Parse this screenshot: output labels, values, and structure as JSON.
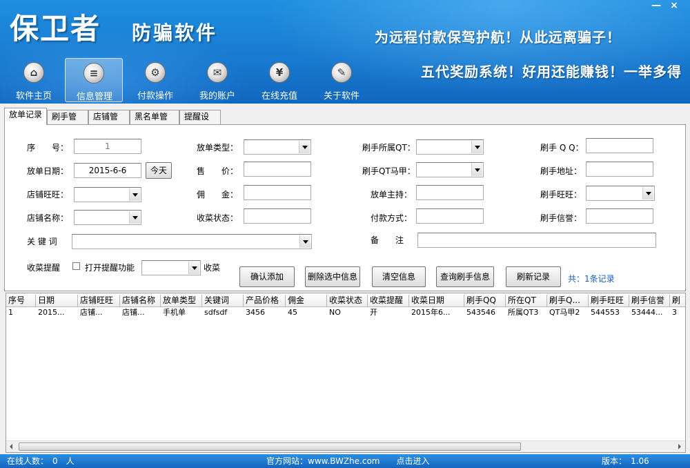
{
  "header": {
    "title": "保卫者",
    "subtitle": "防骗软件",
    "slogan1": "为远程付款保驾护航！从此远离骗子！",
    "slogan2": "五代奖励系统！好用还能赚钱！一举多得",
    "minimize": "—",
    "close": "×"
  },
  "nav": [
    {
      "label": "软件主页",
      "icon": "home-icon",
      "glyph": "⌂"
    },
    {
      "label": "信息管理",
      "icon": "document-icon",
      "glyph": "≡"
    },
    {
      "label": "付款操作",
      "icon": "gears-icon",
      "glyph": "⚙"
    },
    {
      "label": "我的账户",
      "icon": "mail-icon",
      "glyph": "✉"
    },
    {
      "label": "在线充值",
      "icon": "yen-icon",
      "glyph": "¥"
    },
    {
      "label": "关于软件",
      "icon": "microscope-icon",
      "glyph": "✎"
    }
  ],
  "tabs": [
    "放单记录",
    "刷手管理",
    "店铺管理",
    "黑名单管理",
    "提醒设置"
  ],
  "form": {
    "serial_label": "序　　号：",
    "serial_value": "1",
    "date_label": "放单日期：",
    "date_value": "2015-6-6",
    "today_button": "今天",
    "shop_ww_label": "店铺旺旺：",
    "shop_name_label": "店铺名称：",
    "keyword_label": "关 键 词",
    "type_label": "放单类型：",
    "price_label": "售　　价：",
    "commission_label": "佣　　金：",
    "status_label": "收菜状态：",
    "qt_label": "刷手所属QT：",
    "qt_vest_label": "刷手QT马甲：",
    "host_label": "放单主持：",
    "pay_label": "付款方式：",
    "remark_label": "备　　注",
    "qq_label": "刷手 Q Q：",
    "address_label": "刷手地址：",
    "ww_label": "刷手旺旺：",
    "credit_label": "刷手信誉：",
    "reminder_label": "收菜提醒",
    "reminder_check": "打开提醒功能",
    "reminder_suffix": "收菜",
    "buttons": {
      "add": "确认添加",
      "delete": "删除选中信息",
      "clear": "清空信息",
      "query": "查询刷手信息",
      "refresh": "刷新记录"
    },
    "record_count": "共：1条记录"
  },
  "grid": {
    "columns": [
      "序号",
      "日期",
      "店铺旺旺",
      "店铺名称",
      "放单类型",
      "关键词",
      "产品价格",
      "佣金",
      "收菜状态",
      "收菜提醒",
      "收菜日期",
      "刷手QQ",
      "所在QT",
      "刷手Q...",
      "刷手旺旺",
      "刷手信誉",
      "刷"
    ],
    "rows": [
      [
        "1",
        "2015...",
        "店铺...",
        "店铺...",
        "手机单",
        "sdfsdf",
        "3456",
        "45",
        "NO",
        "开",
        "2015年6...",
        "543546",
        "所属QT3",
        "QT马甲2",
        "544553",
        "53444...",
        "3"
      ]
    ]
  },
  "status": {
    "online": "在线人数：　0　人",
    "website": "官方网站：www.BWZhe.com　　点击进入",
    "version": "版本：　1.06"
  }
}
